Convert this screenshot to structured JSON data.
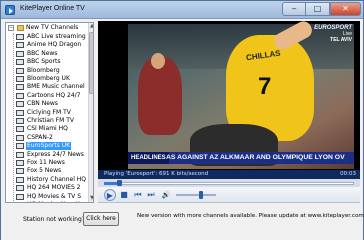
{
  "window": {
    "title": "KitePlayer Online TV",
    "buttons": {
      "minimize": "‒",
      "maximize": "□",
      "close": "✕"
    }
  },
  "tree": {
    "root_label": "New TV Channels",
    "root_expanded": true,
    "channels": [
      "ABC Live streaming",
      "Anime HQ Dragon",
      "BBC News",
      "BBC Sports",
      "Bloomberg",
      "Bloomberg UK",
      "BME Music channel",
      "Cartoons HQ 24/7",
      "CBN News",
      "Ciclying FM TV",
      "Christian FM TV",
      "CSI Miami HQ",
      "CSPAN-2",
      "EuroSports UK",
      "Express 24/7 News",
      "Fox 11 News",
      "Fox 5 News",
      "History Channel HQ",
      "HQ 264 MOVIES 2",
      "HQ Movies & TV S",
      "HQ Movies New Y"
    ],
    "selected_index": 13
  },
  "video": {
    "broadcaster": "EUROSPORT",
    "broadcaster_sub": "Live",
    "broadcaster_city": "TEL AVIV",
    "player_name": "CHILLAS",
    "player_number": "7",
    "ticker_head": "HEADLINES",
    "ticker_text": "AS AGAINST AZ ALKMAAR AND OLYMPIQUE LYON OV"
  },
  "status": {
    "text": "Playing 'Eurosport': 691 K bits/second",
    "time": "00:03"
  },
  "playback": {
    "progress": 0.06,
    "volume": 0.62
  },
  "controls": {
    "play": "▶",
    "stop": "■",
    "prev": "⏮",
    "next": "⏭",
    "mute": "🔊"
  },
  "bottom": {
    "not_working_label": "Station not working?",
    "click_here_label": "Click here",
    "update_message": "New version with more channels available. Please update at www.kiteplayer.com"
  }
}
